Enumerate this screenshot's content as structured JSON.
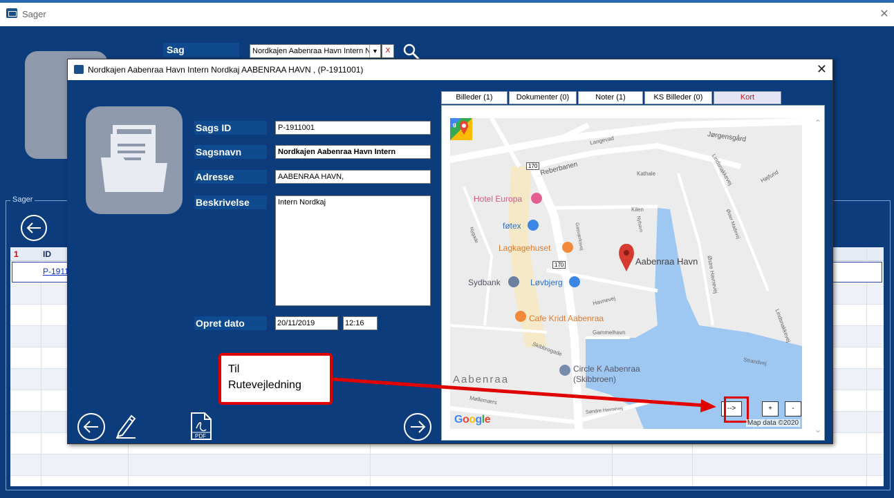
{
  "main_window": {
    "title": "Sager",
    "sag_label": "Sag",
    "sag_value": "Nordkajen Aabenraa Havn  Intern N",
    "clear_label": "X",
    "group_label": "Sager",
    "grid": {
      "col1_header": "1",
      "col2_header": "ID",
      "selected_id": "P-1911001"
    }
  },
  "dialog": {
    "title": "Nordkajen Aabenraa Havn  Intern Nordkaj AABENRAA HAVN ,   (P-1911001)",
    "fields": {
      "sags_id_label": "Sags ID",
      "sags_id_value": "P-1911001",
      "sagsnavn_label": "Sagsnavn",
      "sagsnavn_value": "Nordkajen Aabenraa Havn  Intern",
      "adresse_label": "Adresse",
      "adresse_value": "AABENRAA HAVN,",
      "beskrivelse_label": "Beskrivelse",
      "beskrivelse_value": "Intern Nordkaj",
      "opret_label": "Opret dato",
      "opret_date": "20/11/2019",
      "opret_time": "12:16"
    },
    "tabs": [
      {
        "label": "Billeder (1)"
      },
      {
        "label": "Dokumenter (0)"
      },
      {
        "label": "Noter (1)"
      },
      {
        "label": "KS Billeder (0)"
      },
      {
        "label": "Kort"
      }
    ],
    "map": {
      "labels": {
        "jorgensgard": "Jørgensgård",
        "langevad": "Langevad",
        "reberbanen": "Reberbanen",
        "kathale": "Kathale",
        "lindsnakkevej": "Lindsnakkevej",
        "hojfund": "Højfund",
        "kilen": "Kilen",
        "oster_madevej": "Øster Madevej",
        "nyhavn": "Nyhavn",
        "gasvaerksvej": "Gasværksvej",
        "nygade": "Nygade",
        "hotel_europa": "Hotel Europa",
        "fotex": "føtex",
        "lagkagehuset": "Lagkagehuset",
        "aabenraa_havn": "Aabenraa Havn",
        "ostre_havnevej": "Østre Havnevej",
        "sydbank": "Sydbank",
        "lovbjerg": "Løvbjerg",
        "havnevej": "Havnevej",
        "cafe_kridt": "Cafe Kridt Aabenraa",
        "gammelhavn": "Gammelhavn",
        "skibbrogade": "Skibbrogade",
        "strandvej": "Strandvej",
        "lindsnakkevej2": "Lindsnakkevej",
        "circle_k_1": "Circle K Aabenraa",
        "circle_k_2": "(Skibbroen)",
        "aabenraa": "Aabenraa",
        "mollemaers": "Møllemærs",
        "sondre_havnevej": "Søndre Havnevej",
        "road_170_a": "170",
        "road_170_b": "170"
      },
      "route_button": "-->",
      "zoom_in": "+",
      "zoom_out": "-",
      "attribution": "Map data ©2020",
      "google": "Google"
    }
  },
  "callout": {
    "line1": "Til",
    "line2": "Rutevejledning"
  }
}
